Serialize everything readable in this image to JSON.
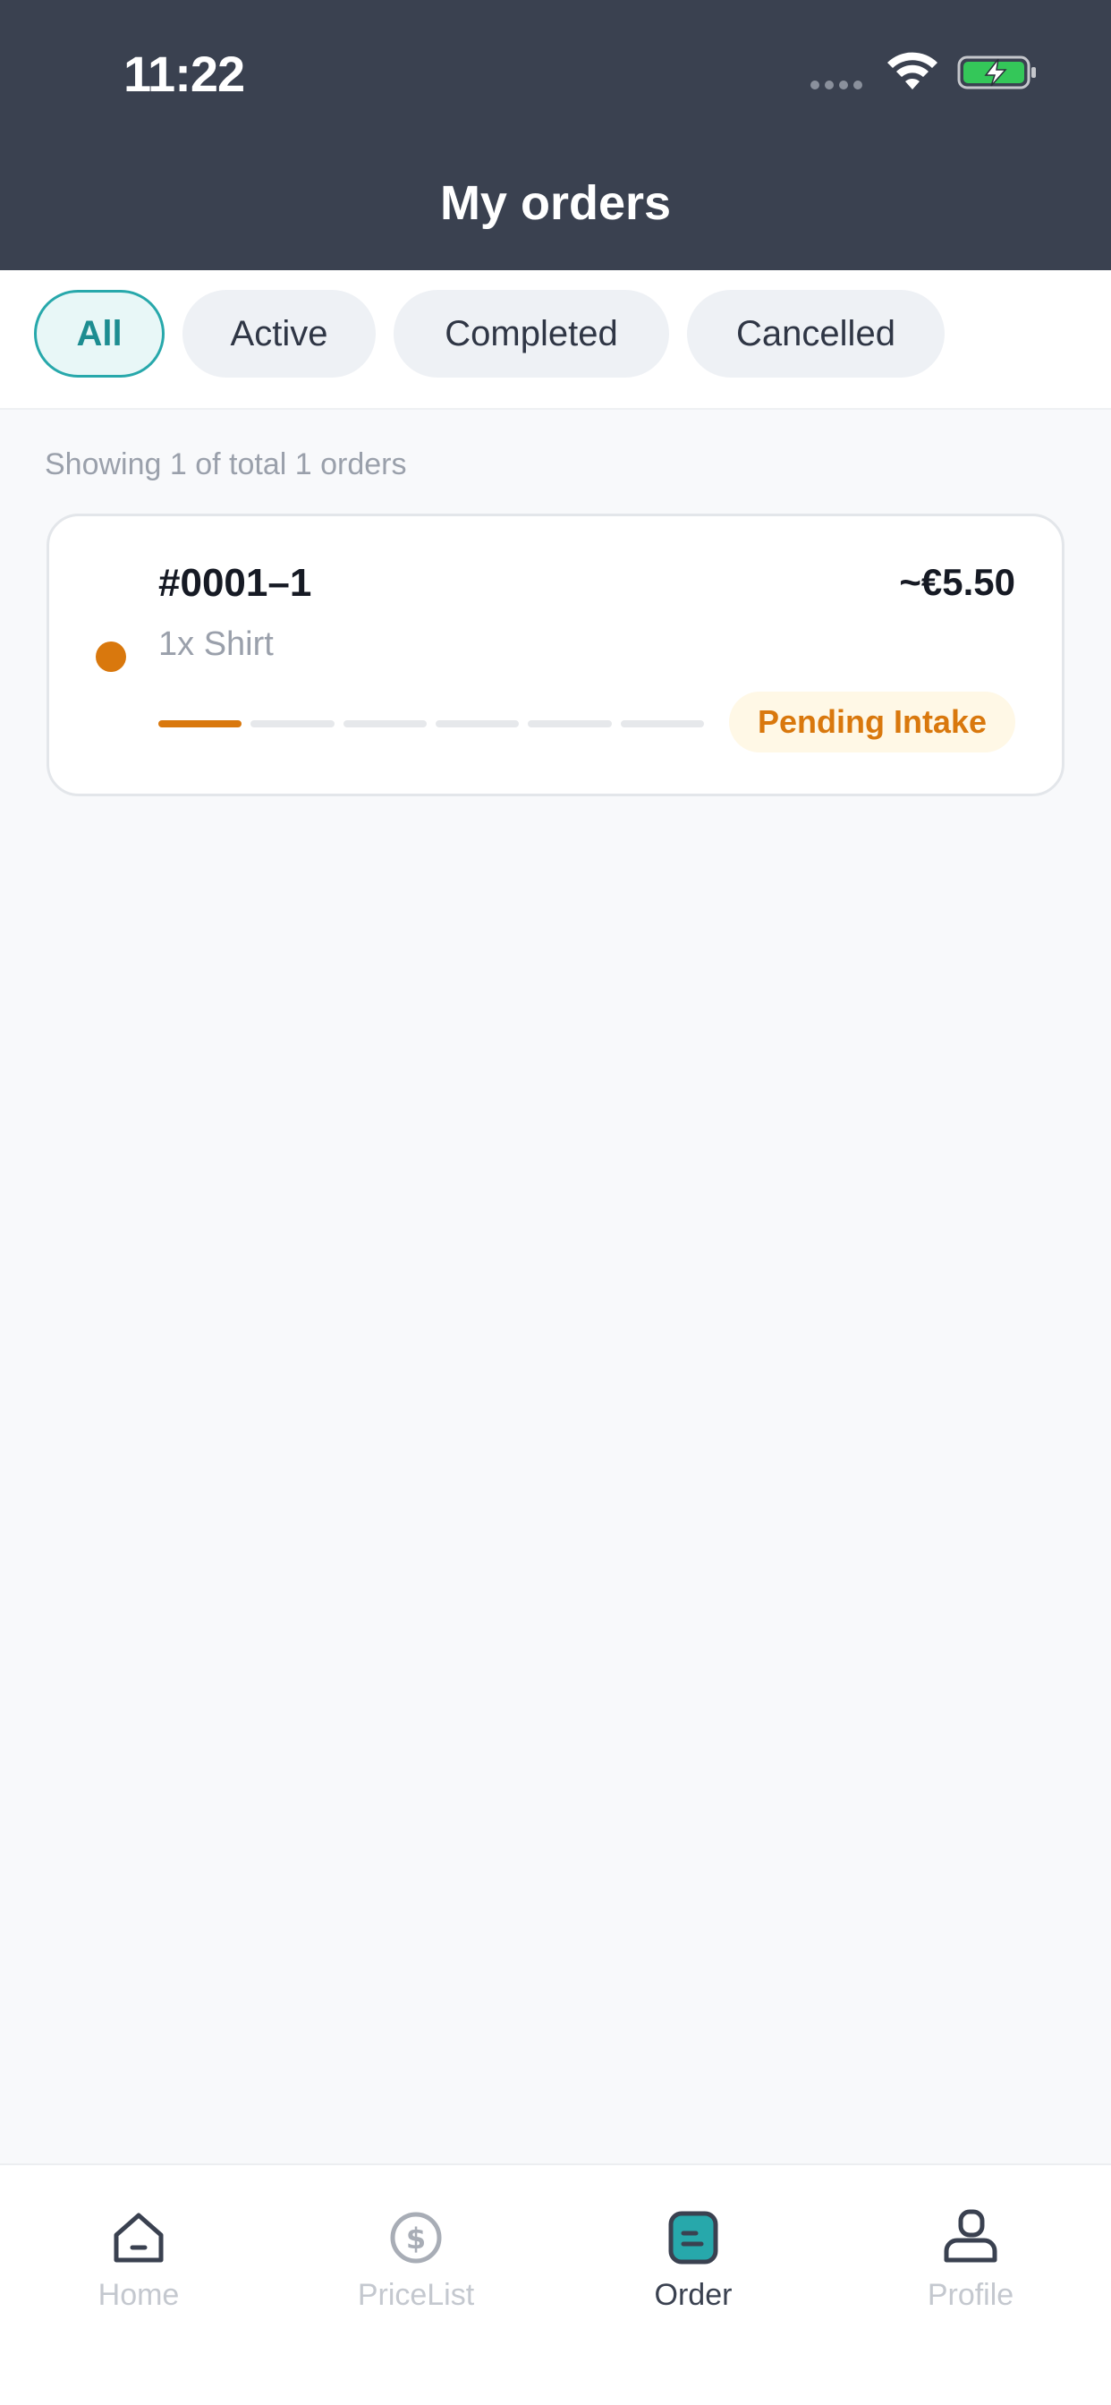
{
  "status_bar": {
    "time": "11:22"
  },
  "header": {
    "title": "My orders"
  },
  "tabs": [
    {
      "label": "All",
      "active": true
    },
    {
      "label": "Active",
      "active": false
    },
    {
      "label": "Completed",
      "active": false
    },
    {
      "label": "Cancelled",
      "active": false
    }
  ],
  "summary": "Showing 1 of total 1 orders",
  "orders": [
    {
      "id": "#0001–1",
      "price": "~€5.50",
      "items": "1x Shirt",
      "status": "Pending Intake",
      "progress_steps_total": 6,
      "progress_steps_done": 1,
      "status_color": "#d9780d"
    }
  ],
  "bottom_nav": [
    {
      "label": "Home",
      "icon": "home-icon"
    },
    {
      "label": "PriceList",
      "icon": "dollar-coin-icon"
    },
    {
      "label": "Order",
      "icon": "order-icon",
      "current": true
    },
    {
      "label": "Profile",
      "icon": "profile-icon"
    }
  ],
  "colors": {
    "accent": "#27a8ab",
    "header_bg": "#3a4150",
    "status_orange": "#d9780d"
  }
}
